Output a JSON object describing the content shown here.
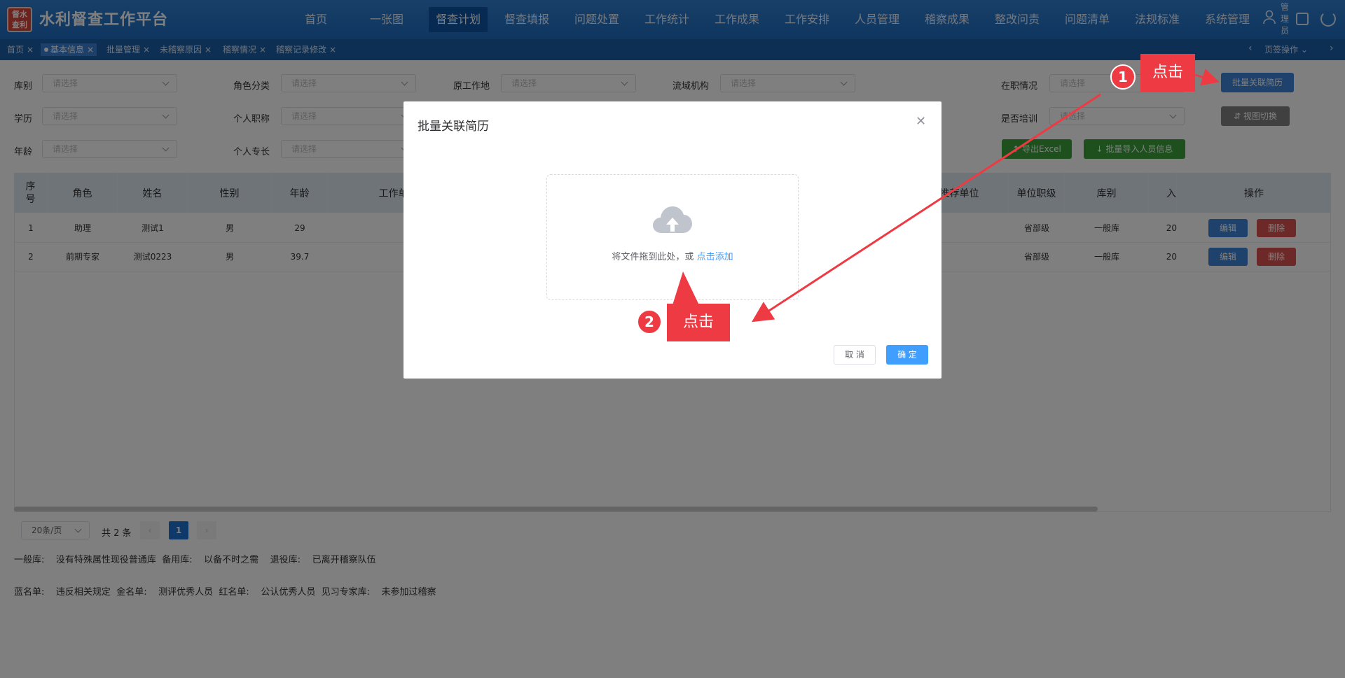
{
  "app": {
    "logo_text": "督水查利",
    "title": "水利督查工作平台"
  },
  "nav": [
    "首页",
    "一张图",
    "督查计划",
    "督查填报",
    "问题处置",
    "工作统计",
    "工作成果",
    "工作安排",
    "人员管理",
    "稽察成果",
    "整改问责",
    "问题清单",
    "法规标准",
    "系统管理"
  ],
  "nav_active": "督查计划",
  "header": {
    "user_label": "管理员"
  },
  "tabs": [
    "首页",
    "基本信息",
    "批量管理",
    "未稽察原因",
    "稽察情况",
    "稽察记录修改"
  ],
  "tab_active": "基本信息",
  "tab_ops": "页签操作",
  "filters": {
    "placeholder": "请选择",
    "ku_bie": "库别",
    "jue_se": "角色分类",
    "yuan_gzd": "原工作地",
    "liu_yu": "流域机构",
    "zai_zhi": "在职情况",
    "xue_li": "学历",
    "zhi_cheng": "个人职称",
    "pei_xun": "是否培训",
    "nian_ling": "年龄",
    "zhuan_chang": "个人专长"
  },
  "buttons": {
    "batch_link": "批量关联简历",
    "view_switch": "视图切换",
    "export": "导出Excel",
    "batch_import": "批量导入人员信息"
  },
  "table": {
    "headers": [
      "序号",
      "角色",
      "姓名",
      "性别",
      "年龄",
      "工作单",
      "推荐单位",
      "单位职级",
      "库别",
      "入",
      "操作"
    ],
    "rows": [
      {
        "no": "1",
        "role": "助理",
        "name": "测试1",
        "gender": "男",
        "age": "29",
        "rank": "省部级",
        "lib": "一般库",
        "year": "20"
      },
      {
        "no": "2",
        "role": "前期专家",
        "name": "测试0223",
        "gender": "男",
        "age": "39.7",
        "rank": "省部级",
        "lib": "一般库",
        "year": "20"
      }
    ],
    "edit_label": "编辑",
    "delete_label": "删除"
  },
  "pager": {
    "page_size": "20条/页",
    "total": "共 2 条",
    "current": "1"
  },
  "legend": {
    "row1": [
      "一般库:",
      "没有特殊属性现役普通库",
      "备用库:",
      "以备不时之需",
      "退役库:",
      "已离开稽察队伍"
    ],
    "row2": [
      "蓝名单:",
      "违反相关规定",
      "金名单:",
      "测评优秀人员",
      "红名单:",
      "公认优秀人员",
      "见习专家库:",
      "未参加过稽察"
    ]
  },
  "dialog": {
    "title": "批量关联简历",
    "upload_text": "将文件拖到此处，或",
    "upload_link": "点击添加",
    "cancel": "取 消",
    "ok": "确 定"
  },
  "annotations": {
    "step1": "1",
    "step1_text": "点击",
    "step2": "2",
    "step2_text": "点击"
  },
  "colors": {
    "header": "#1d6cc0",
    "primary": "#409eff",
    "success": "#3aa13a",
    "danger": "#d9534f",
    "annotation": "#ee3a42"
  }
}
